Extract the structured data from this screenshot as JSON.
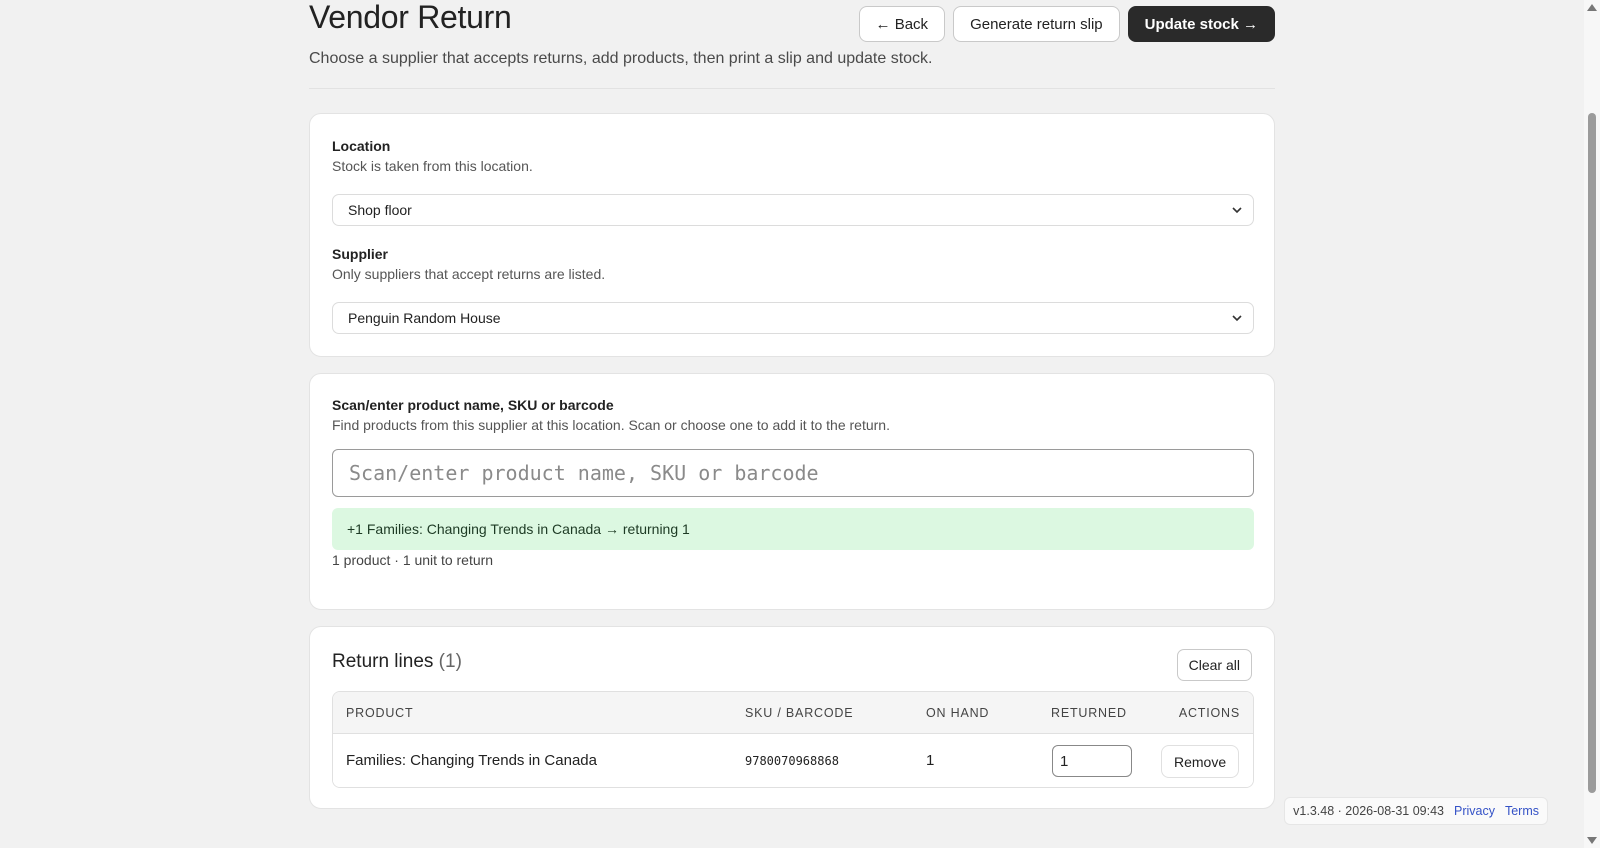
{
  "header": {
    "title": "Vendor Return",
    "subtitle": "Choose a supplier that accepts returns, add products, then print a slip and update stock.",
    "back_label": "← Back",
    "slip_label": "Generate return slip",
    "update_label": "Update stock →"
  },
  "settings": {
    "location_label": "Location",
    "location_help": "Stock is taken from this location.",
    "location_value": "Shop floor",
    "supplier_label": "Supplier",
    "supplier_help": "Only suppliers that accept returns are listed.",
    "supplier_value": "Penguin Random House"
  },
  "scan": {
    "label": "Scan/enter product name, SKU or barcode",
    "help": "Find products from this supplier at this location. Scan or choose one to add it to the return.",
    "placeholder": "Scan/enter product name, SKU or barcode",
    "flash": "+1 Families: Changing Trends in Canada → returning 1",
    "summary": "1 product · 1 unit to return"
  },
  "return_lines": {
    "title": "Return lines",
    "count": "(1)",
    "clear_label": "Clear all",
    "columns": {
      "product": "PRODUCT",
      "sku": "SKU / BARCODE",
      "on_hand": "ON HAND",
      "returned": "RETURNED",
      "actions": "ACTIONS"
    },
    "rows": [
      {
        "product": "Families: Changing Trends in Canada",
        "sku": "9780070968868",
        "on_hand": "1",
        "returned": "1",
        "action": "Remove"
      }
    ]
  },
  "footer": {
    "version": "v1.3.48 · 2026-08-31 09:43",
    "privacy": "Privacy",
    "terms": "Terms"
  }
}
